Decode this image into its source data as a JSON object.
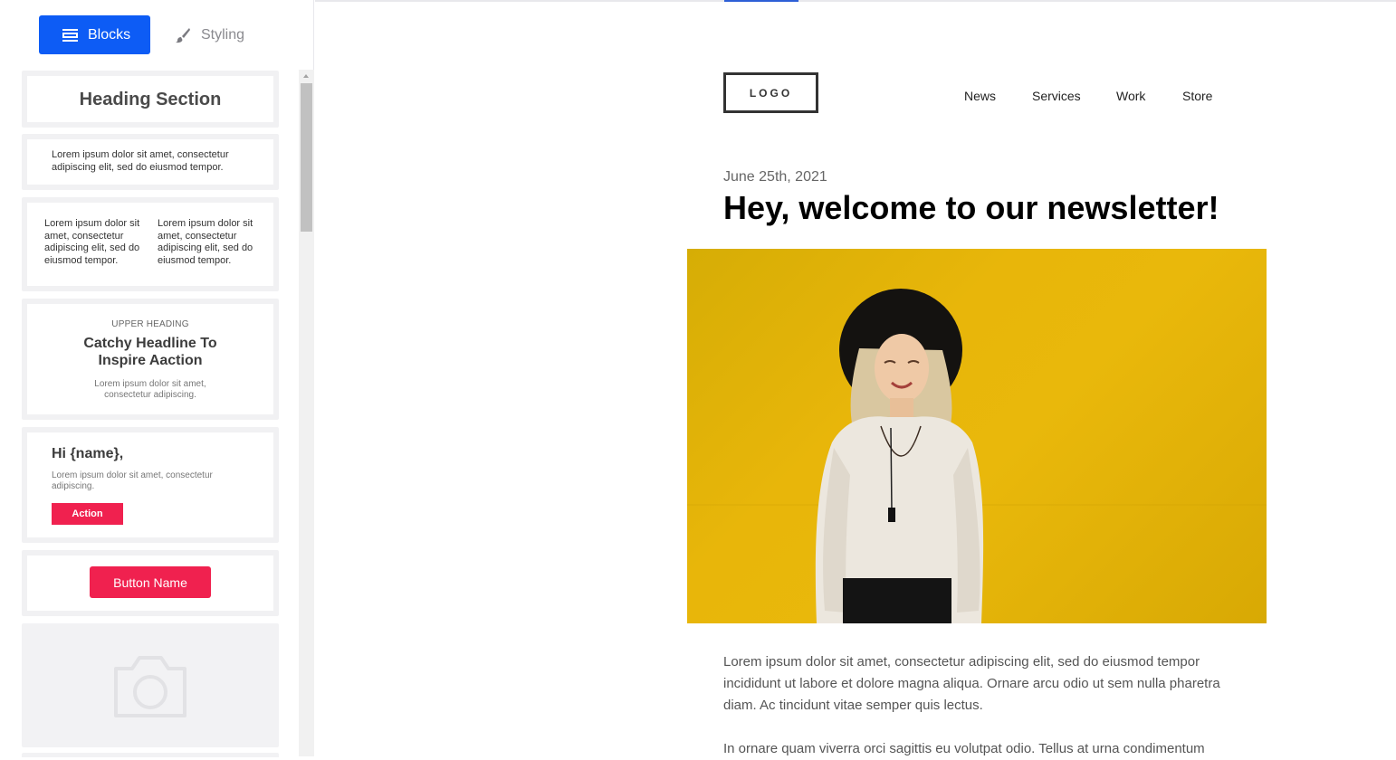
{
  "sidebar": {
    "tabs": {
      "blocks": "Blocks",
      "styling": "Styling"
    },
    "blocks": {
      "heading": "Heading Section",
      "text": "Lorem ipsum dolor sit amet, consectetur adipiscing elit, sed do eiusmod tempor.",
      "two_col_left": "Lorem ipsum dolor sit amet, consectetur adipiscing elit, sed do eiusmod tempor.",
      "two_col_right": "Lorem ipsum dolor sit amet, consectetur adipiscing elit, sed do eiusmod tempor.",
      "hero_upper": "UPPER HEADING",
      "hero_headline": "Catchy Headline To Inspire Aaction",
      "hero_sub": "Lorem ipsum dolor sit amet, consectetur adipiscing.",
      "greeting": "Hi {name},",
      "greeting_sub": "Lorem ipsum dolor sit amet, consectetur adipiscing.",
      "action_button": "Action",
      "button_name": "Button Name"
    },
    "icons": {
      "blocks_tab": "blocks-icon",
      "styling_tab": "brush-icon",
      "image_block": "camera-icon"
    }
  },
  "canvas": {
    "logo": "LOGO",
    "nav": [
      "News",
      "Services",
      "Work",
      "Store"
    ],
    "date": "June 25th, 2021",
    "title": "Hey, welcome to our newsletter!",
    "paragraphs": [
      "Lorem ipsum dolor sit amet, consectetur adipiscing elit, sed do eiusmod tempor incididunt ut labore et dolore magna aliqua. Ornare arcu odio ut sem nulla pharetra diam. Ac tincidunt vitae semper quis lectus.",
      "In ornare quam viverra orci sagittis eu volutpat odio. Tellus at urna condimentum"
    ]
  },
  "colors": {
    "primary": "#0d5cf5",
    "accent": "#f0214f",
    "hero_bg": "#e8b60a"
  }
}
